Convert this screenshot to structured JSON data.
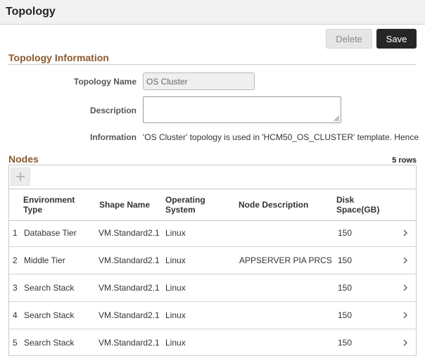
{
  "header": {
    "title": "Topology"
  },
  "toolbar": {
    "delete_label": "Delete",
    "save_label": "Save"
  },
  "topology_info": {
    "section_title": "Topology Information",
    "name_label": "Topology Name",
    "name_value": "OS Cluster",
    "description_label": "Description",
    "description_value": "",
    "information_label": "Information",
    "information_text": "'OS Cluster' topology is used in 'HCM50_OS_CLUSTER' template. Hence"
  },
  "nodes": {
    "section_title": "Nodes",
    "row_count": "5 rows",
    "columns": {
      "environment_type": "Environment Type",
      "shape_name": "Shape Name",
      "operating_system": "Operating System",
      "node_description": "Node Description",
      "disk_space": "Disk Space(GB)"
    },
    "rows": [
      {
        "num": "1",
        "env": "Database Tier",
        "shape": "VM.Standard2.1",
        "os": "Linux",
        "desc": "",
        "disk": "150"
      },
      {
        "num": "2",
        "env": "Middle Tier",
        "shape": "VM.Standard2.1",
        "os": "Linux",
        "desc": "APPSERVER PIA PRCS",
        "disk": "150"
      },
      {
        "num": "3",
        "env": "Search Stack",
        "shape": "VM.Standard2.1",
        "os": "Linux",
        "desc": "",
        "disk": "150"
      },
      {
        "num": "4",
        "env": "Search Stack",
        "shape": "VM.Standard2.1",
        "os": "Linux",
        "desc": "",
        "disk": "150"
      },
      {
        "num": "5",
        "env": "Search Stack",
        "shape": "VM.Standard2.1",
        "os": "Linux",
        "desc": "",
        "disk": "150"
      }
    ]
  },
  "icons": {
    "add": "plus-icon",
    "row_detail": "chevron-right-icon",
    "resize": "resize-grip-icon"
  },
  "colors": {
    "section_title": "#8a5a2e",
    "save_button": "#262626",
    "delete_button": "#e6e6e6"
  }
}
